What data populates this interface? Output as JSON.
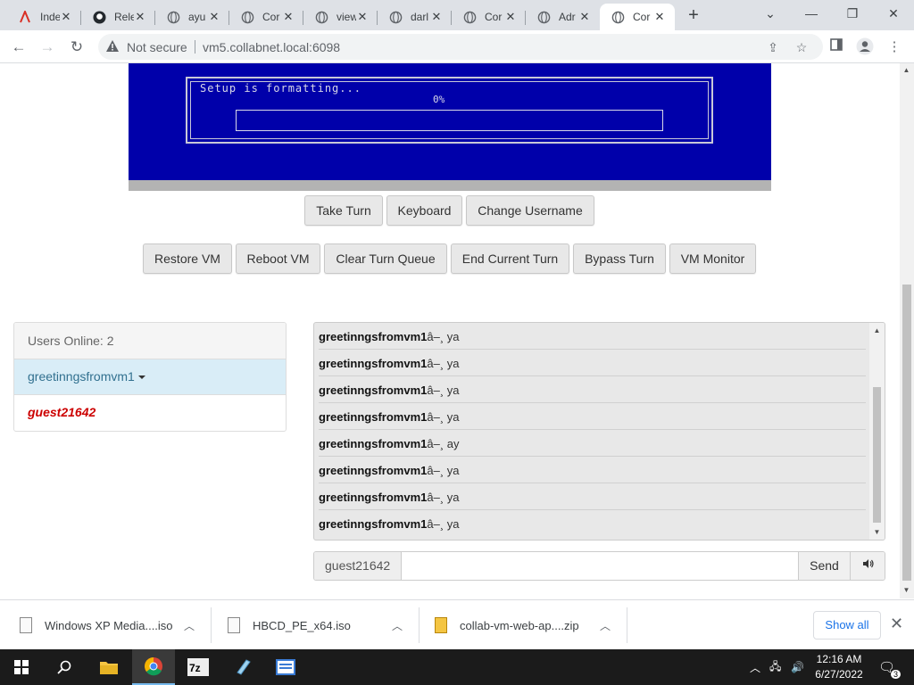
{
  "browser": {
    "tabs": [
      {
        "title": "Inde",
        "icon": "pdf-icon"
      },
      {
        "title": "Rele",
        "icon": "github-icon"
      },
      {
        "title": "ayu",
        "icon": "globe-icon"
      },
      {
        "title": "Cor",
        "icon": "globe-icon"
      },
      {
        "title": "view",
        "icon": "globe-icon"
      },
      {
        "title": "darl",
        "icon": "globe-icon"
      },
      {
        "title": "Cor",
        "icon": "globe-icon"
      },
      {
        "title": "Adr",
        "icon": "globe-icon"
      },
      {
        "title": "Cor",
        "icon": "globe-icon"
      }
    ],
    "security_label": "Not secure",
    "url": "vm5.collabnet.local:6098"
  },
  "vm": {
    "setup_text": "Setup is formatting...",
    "progress_label": "0%",
    "progress": 0
  },
  "turn_buttons": [
    "Take Turn",
    "Keyboard",
    "Change Username"
  ],
  "admin_buttons": [
    "Restore VM",
    "Reboot VM",
    "Clear Turn Queue",
    "End Current Turn",
    "Bypass Turn",
    "VM Monitor"
  ],
  "users": {
    "header": "Users Online: 2",
    "list": [
      "greetinngsfromvm1",
      "guest21642"
    ]
  },
  "chat": {
    "messages": [
      {
        "user": "greetinngsfromvm1",
        "text": "â–¸ ya"
      },
      {
        "user": "greetinngsfromvm1",
        "text": "â–¸ ya"
      },
      {
        "user": "greetinngsfromvm1",
        "text": "â–¸ ya"
      },
      {
        "user": "greetinngsfromvm1",
        "text": "â–¸ ya"
      },
      {
        "user": "greetinngsfromvm1",
        "text": "â–¸ ay"
      },
      {
        "user": "greetinngsfromvm1",
        "text": "â–¸ ya"
      },
      {
        "user": "greetinngsfromvm1",
        "text": "â–¸ ya"
      },
      {
        "user": "greetinngsfromvm1",
        "text": "â–¸ ya"
      }
    ],
    "username": "guest21642",
    "input_value": "",
    "send_label": "Send"
  },
  "downloads": {
    "items": [
      {
        "name": "Windows XP Media....iso"
      },
      {
        "name": "HBCD_PE_x64.iso"
      },
      {
        "name": "collab-vm-web-ap....zip"
      }
    ],
    "show_all": "Show all"
  },
  "taskbar": {
    "time": "12:16 AM",
    "date": "6/27/2022",
    "notification_count": "3"
  },
  "colors": {
    "vm_background": "#0000aa",
    "highlight_user": "#d9edf7",
    "current_user": "#cc0000",
    "link_blue": "#1a73e8"
  }
}
